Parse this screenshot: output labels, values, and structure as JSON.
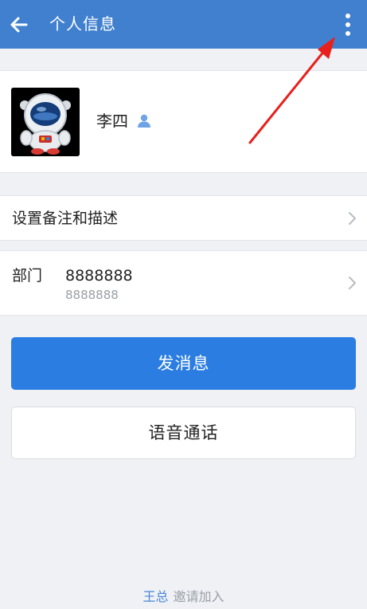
{
  "header": {
    "title": "个人信息",
    "back_icon": "arrow-left-icon",
    "more_icon": "more-vertical-icon",
    "background_color": "#4180cf"
  },
  "profile": {
    "name": "李四",
    "avatar": "astronaut-avatar",
    "contact_icon": "person-icon",
    "contact_icon_color": "#6ea3e6"
  },
  "rows": {
    "remark": {
      "label": "设置备注和描述"
    },
    "department": {
      "label": "部门",
      "value": "8888888",
      "sub_value": "8888888"
    }
  },
  "actions": {
    "send_message": "发消息",
    "voice_call": "语音通话",
    "primary_color": "#2b7de2"
  },
  "footer": {
    "inviter": "王总",
    "invite_text": "邀请加入"
  },
  "annotation": {
    "arrow_color": "#e8201c"
  }
}
